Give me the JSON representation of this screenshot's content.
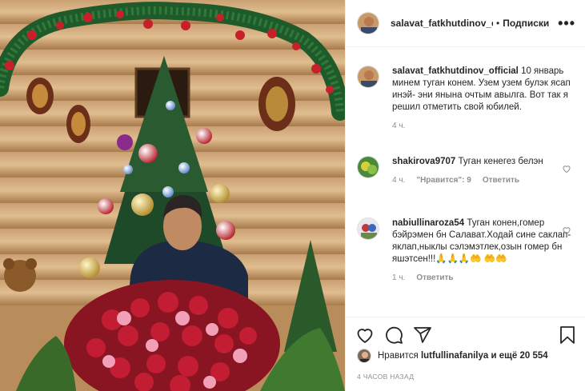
{
  "post": {
    "username": "salavat_fatkhutdinov_c",
    "dot": "•",
    "follow_label": "Подписки",
    "more_label": "•••"
  },
  "comments": [
    {
      "user": "salavat_fatkhutdinov_official",
      "text": "10 январь минем туган конем. Узем узем булэк ясап инэй- эни янына очтым авылга. Вот так я решил отметить свой юбилей.",
      "time": "4 ч."
    },
    {
      "user": "shakirova9707",
      "text": "Туган кенегез белэн",
      "time": "4 ч.",
      "likes": "\"Нравится\": 9",
      "reply": "Ответить"
    },
    {
      "user": "nabiullinaroza54",
      "text": "Туган конен,гомер бэйрэмен бн Салават.Ходай сине саклап-яклап,ныклы сэлэмэтлек,озын гомер бн яшэтсен!!!🙏🙏🙏🤲 🤲🤲",
      "time": "1 ч.",
      "reply": "Ответить"
    }
  ],
  "likes": {
    "prefix": "Нравится",
    "user": "lutfullinafanilya",
    "suffix": "и ещё 20 554"
  },
  "timestamp": "4 ЧАСОВ НАЗАД",
  "icons": [
    "heart-icon",
    "comment-icon",
    "share-icon",
    "bookmark-icon",
    "more-icon"
  ]
}
